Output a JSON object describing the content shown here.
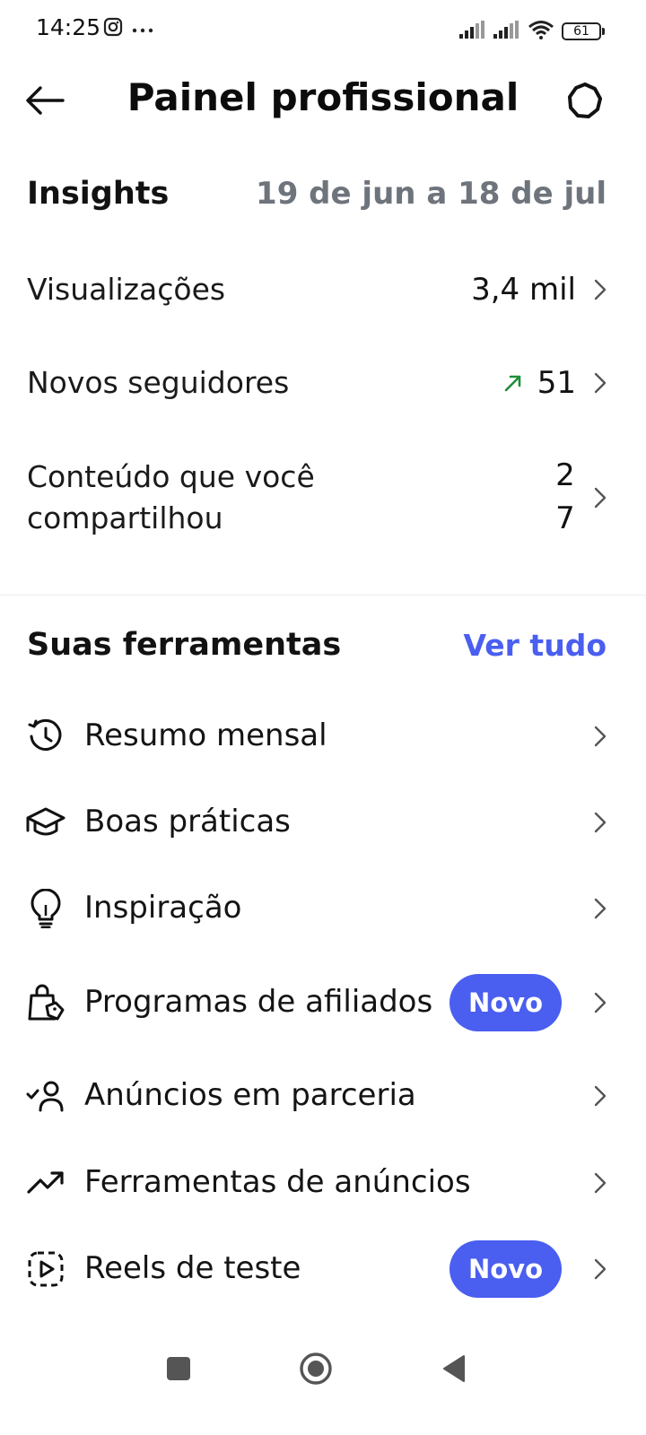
{
  "status_bar": {
    "time": "14:25",
    "battery": "61",
    "icons": [
      "instagram-notification-icon",
      "more-dots-icon",
      "signal-icon",
      "signal-icon",
      "wifi-icon",
      "battery-icon"
    ]
  },
  "header": {
    "title": "Painel profissional",
    "icons": [
      "back-arrow-icon",
      "gear-icon"
    ]
  },
  "insights": {
    "title": "Insights",
    "date_range": "19 de jun a 18 de jul",
    "rows": [
      {
        "label": "Visualizações",
        "value": "3,4 mil"
      },
      {
        "label": "Novos seguidores",
        "value": "51",
        "trend_icon": "trend-up-arrow-icon",
        "trend_color": "#1e8f3a"
      },
      {
        "label": "Conteúdo que você compartilhou",
        "value": "27"
      }
    ]
  },
  "tools": {
    "title": "Suas ferramentas",
    "see_all": "Ver tudo",
    "items": [
      {
        "label": "Resumo mensal",
        "icon": "history-clock-icon"
      },
      {
        "label": "Boas práticas",
        "icon": "graduation-cap-icon"
      },
      {
        "label": "Inspiração",
        "icon": "lightbulb-icon"
      },
      {
        "label": "Programas de afiliados",
        "icon": "shopping-bag-tag-icon",
        "badge": "Novo"
      },
      {
        "label": "Anúncios em parceria",
        "icon": "person-check-icon"
      },
      {
        "label": "Ferramentas de anúncios",
        "icon": "trending-chart-icon"
      },
      {
        "label": "Reels de teste",
        "icon": "reels-play-dashed-icon",
        "badge": "Novo"
      }
    ]
  },
  "colors": {
    "accent": "#4a5ef0",
    "muted_text": "#6e747c",
    "trend_green": "#1e8f3a"
  },
  "nav_bar": {
    "icons": [
      "recents-square-icon",
      "home-circle-icon",
      "back-triangle-icon"
    ]
  }
}
